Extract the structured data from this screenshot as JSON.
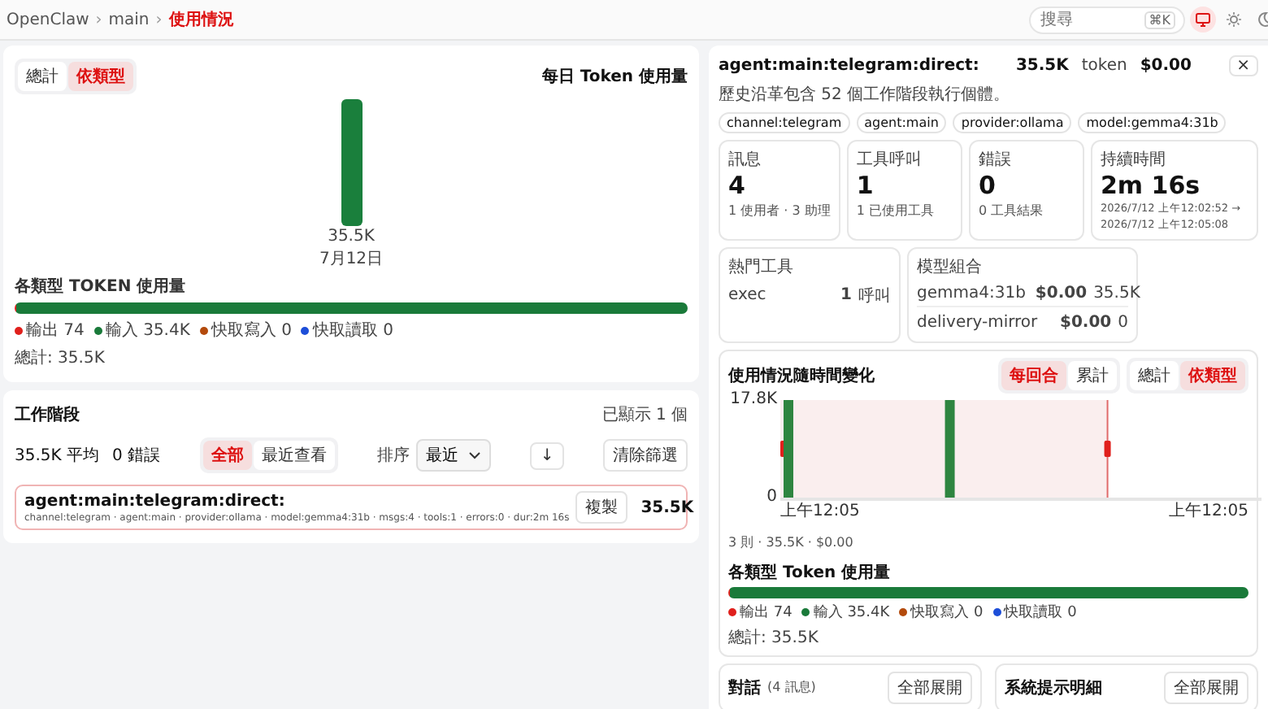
{
  "breadcrumb": [
    {
      "label": "OpenClaw",
      "current": false
    },
    {
      "label": "main",
      "current": false
    },
    {
      "label": "使用情況",
      "current": true
    }
  ],
  "breadcrumb_separator": "›",
  "search": {
    "placeholder": "搜尋",
    "shortcut": "⌘K"
  },
  "theme_buttons": [
    {
      "kind": "monitor",
      "selected": true
    },
    {
      "kind": "sun",
      "selected": false
    },
    {
      "kind": "moon",
      "selected": false
    }
  ],
  "daily_card": {
    "toggle": [
      {
        "label": "總計",
        "selected": false
      },
      {
        "label": "依類型",
        "selected": true
      }
    ],
    "title": "每日 Token 使用量",
    "chart_data": {
      "type": "bar",
      "categories": [
        "7月12日"
      ],
      "values": [
        35500
      ],
      "ylim": [
        0,
        35500
      ],
      "value_labels": [
        "35.5K"
      ]
    }
  },
  "type_usage": {
    "title": "各類型 TOKEN 使用量",
    "segments": [
      {
        "label": "輸出 74",
        "color": "#e0201c",
        "level": 0.002
      },
      {
        "label": "輸入 35.4K",
        "color": "#1a7a3a",
        "level": 0.998
      },
      {
        "label": "快取寫入 0",
        "color": "#b34a0c",
        "level": 0
      },
      {
        "label": "快取讀取 0",
        "color": "#1d4ed8",
        "level": 0
      }
    ],
    "total": "總計: 35.5K"
  },
  "sessions": {
    "title": "工作階段",
    "shown": "已顯示 1 個",
    "average": "35.5K 平均",
    "errors": "0 錯誤",
    "filter": [
      {
        "label": "全部",
        "selected": true
      },
      {
        "label": "最近查看",
        "selected": false
      }
    ],
    "sort_label": "排序",
    "sort_value": "最近",
    "direction": "↓",
    "clear": "清除篩選",
    "rows": [
      {
        "title": "agent:main:telegram:direct:",
        "meta": "channel:telegram · agent:main · provider:ollama · model:gemma4:31b · msgs:4 · tools:1 · errors:0 · dur:2m 16s",
        "copy": "複製",
        "tokens": "35.5K",
        "selected": true
      }
    ]
  },
  "detail": {
    "title": "agent:main:telegram:direct:",
    "tokens": "35.5K",
    "tokens_unit": "token",
    "cost": "$0.00",
    "close": "×",
    "subtitle": "歷史沿革包含 52 個工作階段執行個體。",
    "chips": [
      "channel:telegram",
      "agent:main",
      "provider:ollama",
      "model:gemma4:31b"
    ],
    "stats": [
      {
        "label": "訊息",
        "value": "4",
        "notes": [
          "1 使用者 · 3 助理"
        ]
      },
      {
        "label": "工具呼叫",
        "value": "1",
        "notes": [
          "1 已使用工具"
        ]
      },
      {
        "label": "錯誤",
        "value": "0",
        "notes": [
          "0 工具結果"
        ]
      },
      {
        "label": "持續時間",
        "value": "2m 16s",
        "notes": [
          "2026/7/12 上午12:02:52 →",
          "2026/7/12 上午12:05:08"
        ]
      }
    ],
    "top_tools": {
      "title": "熱門工具",
      "rows": [
        {
          "name": "exec",
          "count": "1",
          "unit": "呼叫"
        }
      ]
    },
    "models": {
      "title": "模型組合",
      "rows": [
        {
          "name": "gemma4:31b",
          "cost": "$0.00",
          "tokens": "35.5K"
        },
        {
          "name": "delivery-mirror",
          "cost": "$0.00",
          "tokens": "0"
        }
      ]
    },
    "timeline": {
      "title": "使用情況隨時間變化",
      "mode": [
        {
          "label": "每回合",
          "selected": true
        },
        {
          "label": "累計",
          "selected": false
        }
      ],
      "view": [
        {
          "label": "總計",
          "selected": false
        },
        {
          "label": "依類型",
          "selected": true
        }
      ],
      "chart_data": {
        "type": "bar",
        "categories": [
          "上午12:05",
          null,
          "上午12:05"
        ],
        "values": [
          17800,
          17800,
          null
        ],
        "ylim": [
          0,
          17800
        ],
        "yticks": [
          {
            "value": 0,
            "label": "0"
          },
          {
            "value": 17800,
            "label": "17.8K"
          }
        ]
      },
      "selection": {
        "level": 0.68
      },
      "summary": "3 則 · 35.5K · $0.00"
    },
    "type_usage": {
      "title": "各類型 Token 使用量",
      "segments": [
        {
          "label": "輸出 74",
          "color": "#e0201c",
          "level": 0.002
        },
        {
          "label": "輸入 35.4K",
          "color": "#1a7a3a",
          "level": 0.998
        },
        {
          "label": "快取寫入 0",
          "color": "#b34a0c",
          "level": 0
        },
        {
          "label": "快取讀取 0",
          "color": "#1d4ed8",
          "level": 0
        }
      ],
      "total": "總計: 35.5K"
    },
    "bottom_cards": [
      {
        "title": "對話",
        "note": "(4 訊息)",
        "button": "全部展開"
      },
      {
        "title": "系統提示明細",
        "button": "全部展開"
      }
    ]
  }
}
